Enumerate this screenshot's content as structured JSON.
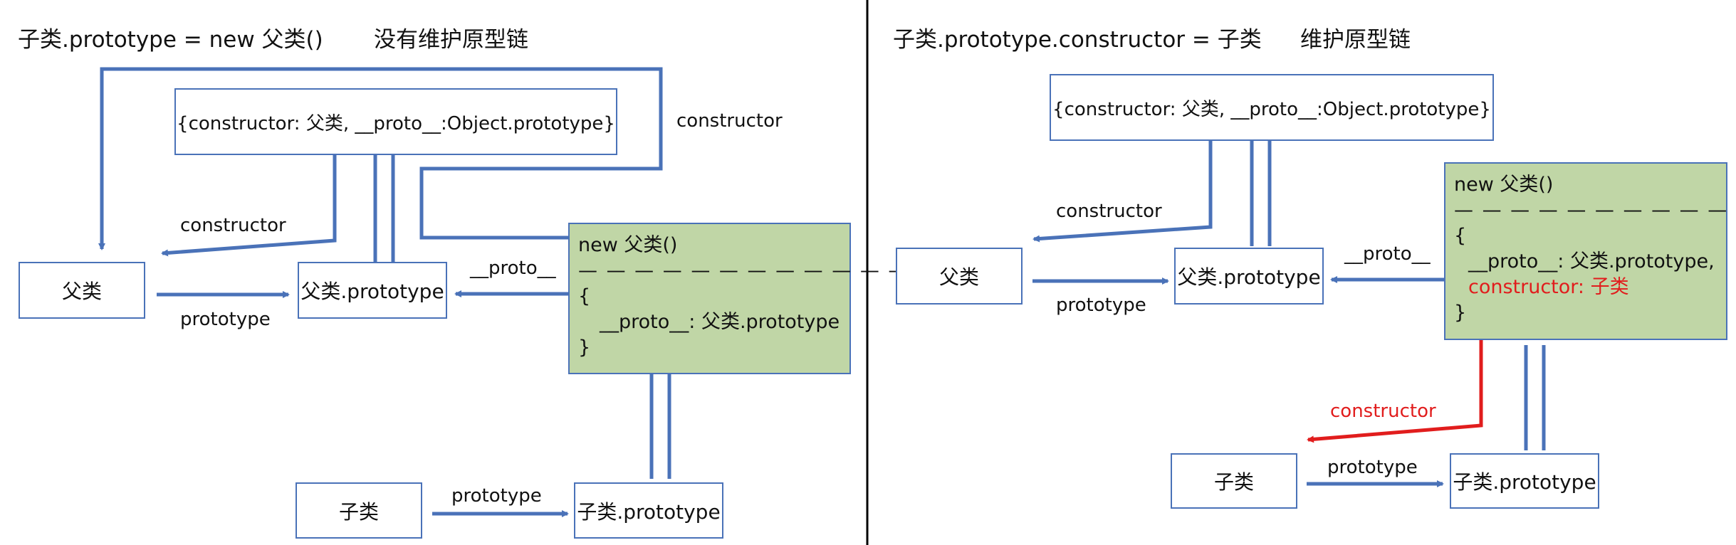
{
  "left": {
    "heading": "子类.prototype = new 父类()",
    "note": "没有维护原型链",
    "proto_object_box": "{constructor: 父类,  __proto__:Object.prototype}",
    "parent_box": "父类",
    "parent_prototype_box": "父类.prototype",
    "child_box": "子类",
    "child_prototype_box": "子类.prototype",
    "instance_box": {
      "line1": "new 父类()",
      "line2": "— — — — — — — — — — — — —",
      "line3": "{",
      "line4": "__proto__: 父类.prototype",
      "line5": "}"
    },
    "labels": {
      "constructor_top": "constructor",
      "constructor_mid": "constructor",
      "proto": "__proto__",
      "prototype_parent": "prototype",
      "prototype_child": "prototype"
    }
  },
  "right": {
    "heading": "子类.prototype.constructor = 子类",
    "note": "维护原型链",
    "proto_object_box": "{constructor: 父类,  __proto__:Object.prototype}",
    "parent_box": "父类",
    "parent_prototype_box": "父类.prototype",
    "child_box": "子类",
    "child_prototype_box": "子类.prototype",
    "instance_box": {
      "line1": "new 父类()",
      "line2": "— — — — — — — — — — — — —",
      "line3": "{",
      "line4": "__proto__: 父类.prototype,",
      "line5": "constructor: 子类",
      "line6": "}"
    },
    "labels": {
      "constructor": "constructor",
      "proto": "__proto__",
      "prototype_parent": "prototype",
      "constructor_red": "constructor",
      "prototype_child": "prototype"
    }
  },
  "colors": {
    "connector": "#4a72b8",
    "instance_fill": "#c0d6a6",
    "highlight": "#e11d1d",
    "divider": "#000000"
  }
}
